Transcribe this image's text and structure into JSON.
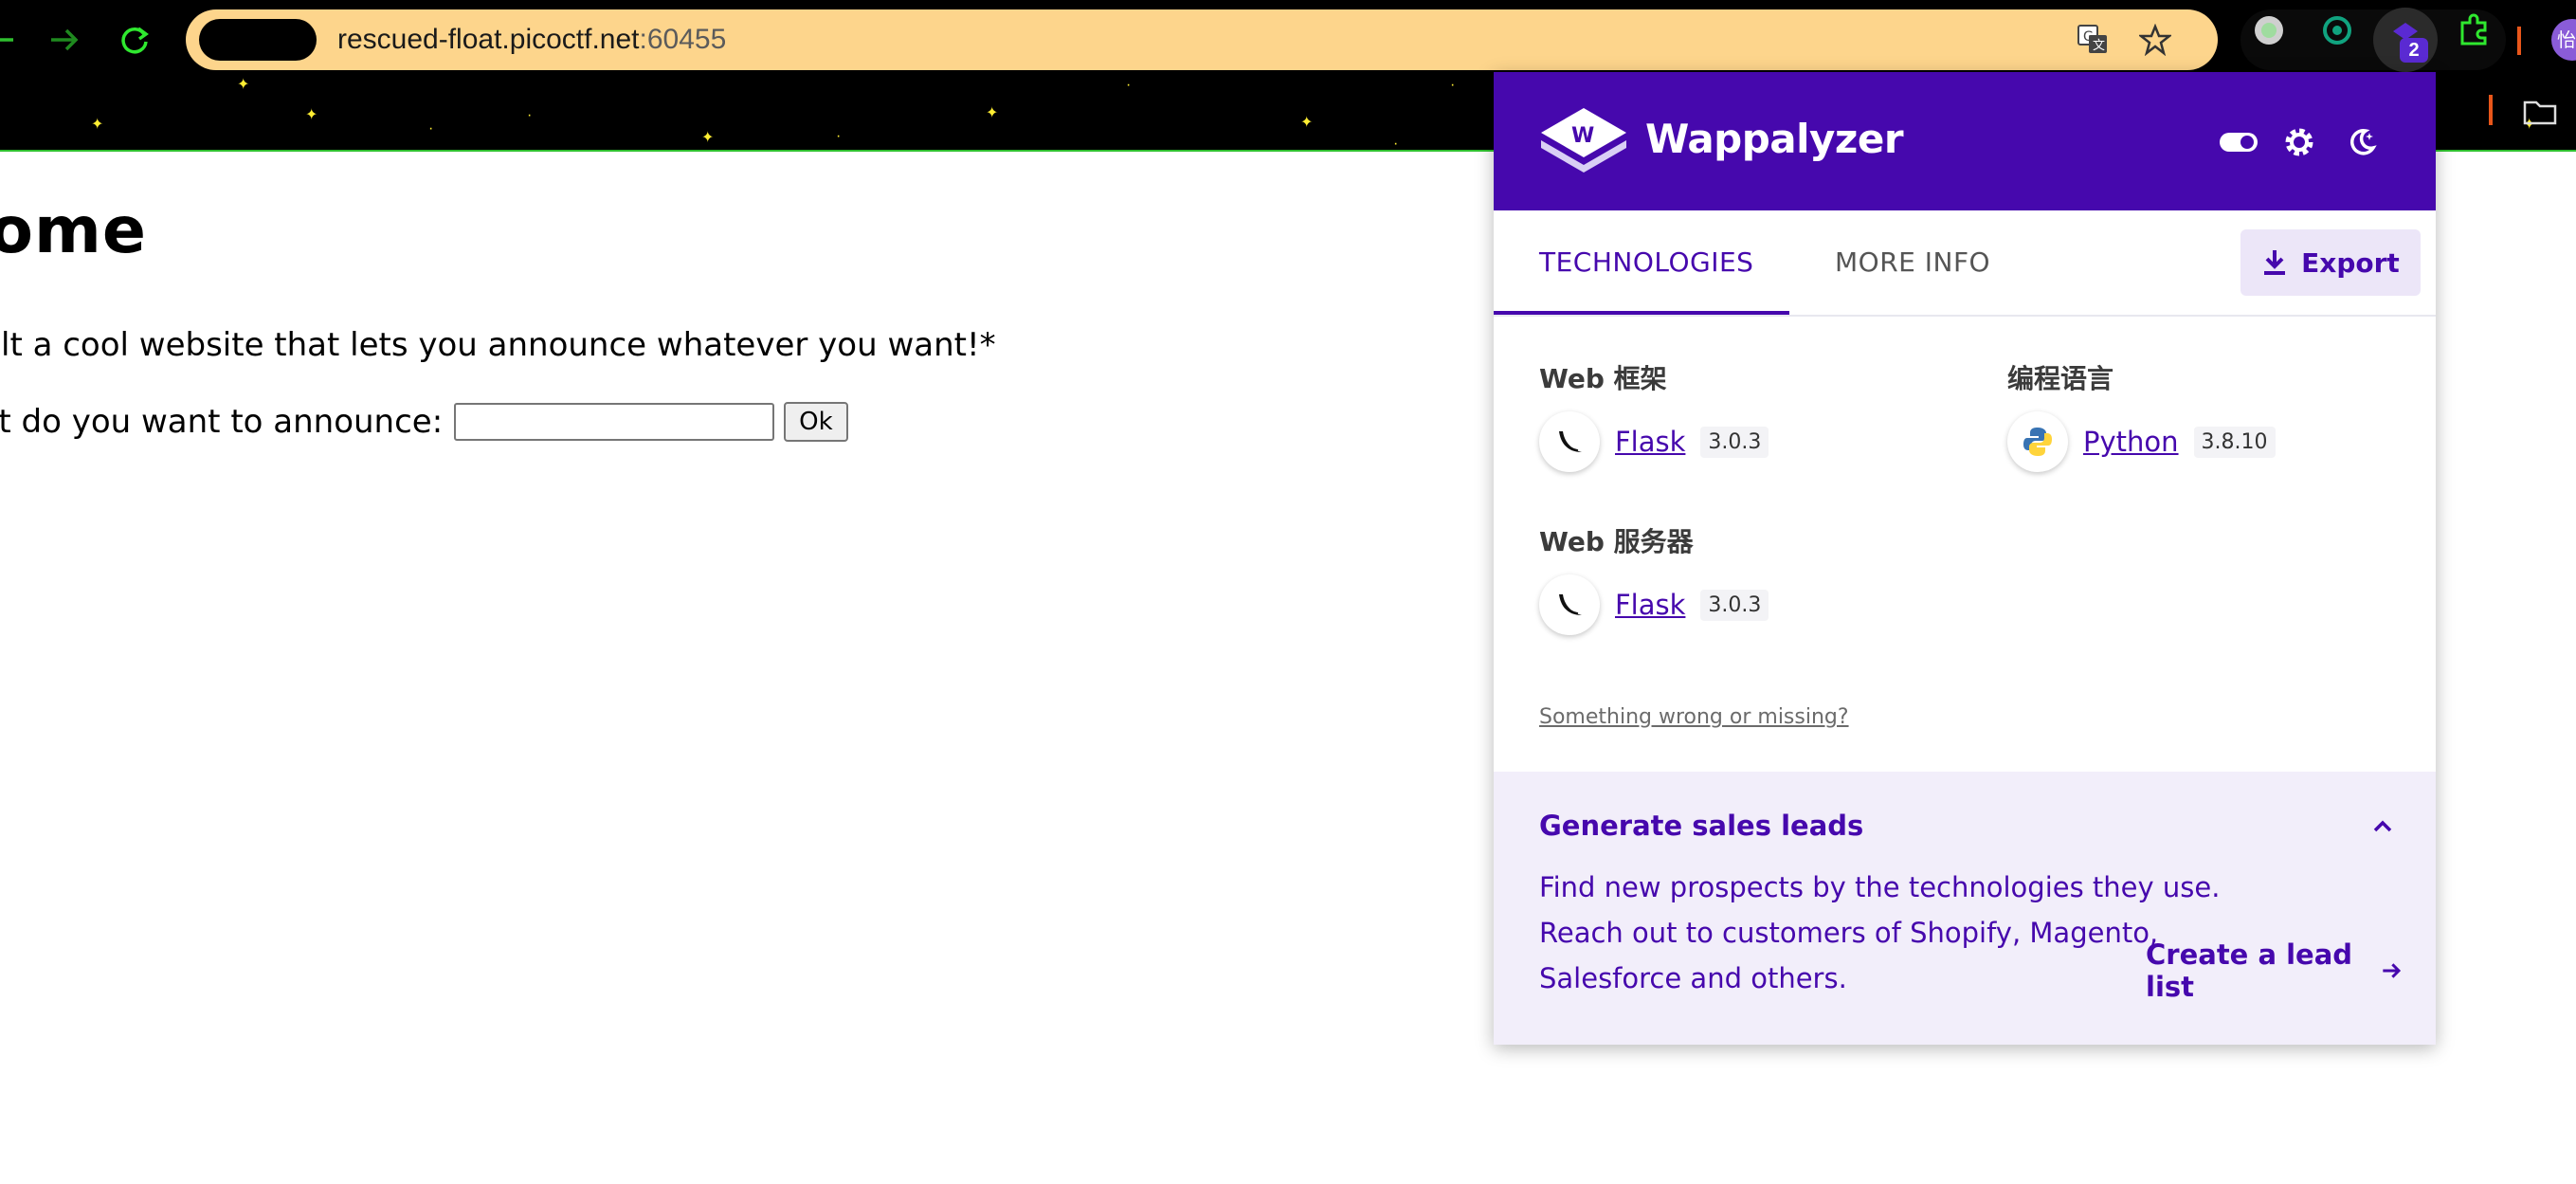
{
  "browser": {
    "url_host": "rescued-float.picoctf.net",
    "url_port": ":60455",
    "tab_badge_count": "2",
    "profile_initial": "怡"
  },
  "page": {
    "title": "lome",
    "description": "uilt a cool website that lets you announce whatever you want!*",
    "form_label": "nat do you want to announce:",
    "input_value": "",
    "ok_button": "Ok"
  },
  "wappalyzer": {
    "brand": "Wappalyzer",
    "tabs": [
      {
        "label": "TECHNOLOGIES",
        "active": true
      },
      {
        "label": "MORE INFO",
        "active": false
      }
    ],
    "export_label": "Export",
    "categories": [
      {
        "name": "Web 框架",
        "techs": [
          {
            "name": "Flask",
            "version": "3.0.3",
            "icon": "flask-icon"
          }
        ]
      },
      {
        "name": "编程语言",
        "techs": [
          {
            "name": "Python",
            "version": "3.8.10",
            "icon": "python-icon"
          }
        ]
      },
      {
        "name": "Web 服务器",
        "techs": [
          {
            "name": "Flask",
            "version": "3.0.3",
            "icon": "flask-icon"
          }
        ]
      }
    ],
    "missing_link": "Something wrong or missing?",
    "leads": {
      "title": "Generate sales leads",
      "text": "Find new prospects by the technologies they use. Reach out to customers of Shopify, Magento, Salesforce and others.",
      "cta": "Create a lead list"
    }
  },
  "colors": {
    "wappalyzer_purple": "#4608ad",
    "omnibox": "#fdd58c",
    "leads_bg": "#f2eefa",
    "star": "#ffee33"
  }
}
